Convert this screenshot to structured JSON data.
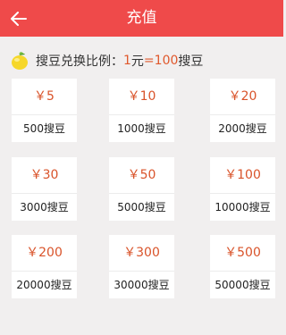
{
  "header": {
    "title": "充值",
    "back_icon": "arrow-left-icon"
  },
  "rate": {
    "icon": "lemon-icon",
    "label": "搜豆兑换比例：",
    "one": "1",
    "unit_yuan": "元",
    "eq": "=",
    "hundred": "100",
    "unit_bean": "搜豆"
  },
  "packages": [
    {
      "price": "￥5",
      "beans": "500搜豆"
    },
    {
      "price": "￥10",
      "beans": "1000搜豆"
    },
    {
      "price": "￥20",
      "beans": "2000搜豆"
    },
    {
      "price": "￥30",
      "beans": "3000搜豆"
    },
    {
      "price": "￥50",
      "beans": "5000搜豆"
    },
    {
      "price": "￥100",
      "beans": "10000搜豆"
    },
    {
      "price": "￥200",
      "beans": "20000搜豆"
    },
    {
      "price": "￥300",
      "beans": "30000搜豆"
    },
    {
      "price": "￥500",
      "beans": "50000搜豆"
    }
  ],
  "colors": {
    "header": "#ef4a4a",
    "price": "#d9532a",
    "background": "#f1efef"
  }
}
